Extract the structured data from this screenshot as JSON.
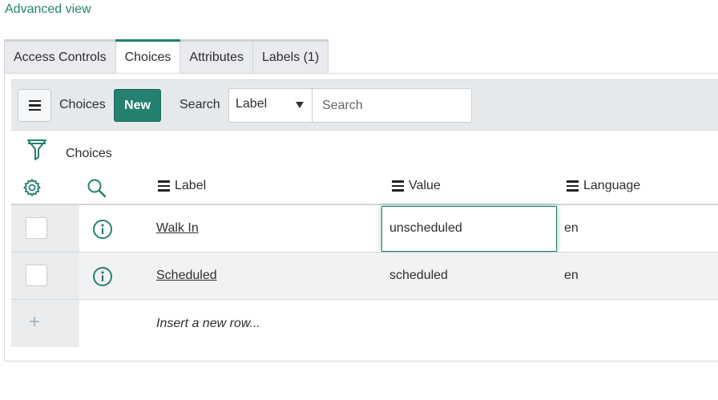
{
  "advanced_view_link": "Advanced view",
  "tabs": [
    {
      "label": "Access Controls",
      "active": false
    },
    {
      "label": "Choices",
      "active": true
    },
    {
      "label": "Attributes",
      "active": false
    },
    {
      "label": "Labels (1)",
      "active": false
    }
  ],
  "list_header": {
    "title": "Choices",
    "new_button": "New",
    "search_label": "Search",
    "search_field_selected": "Label",
    "search_placeholder": "Search"
  },
  "breadcrumb": "Choices",
  "columns": [
    "Label",
    "Value",
    "Language"
  ],
  "rows": [
    {
      "label": "Walk In",
      "value": "unscheduled",
      "language": "en",
      "editing": true
    },
    {
      "label": "Scheduled",
      "value": "scheduled",
      "language": "en",
      "editing": false
    }
  ],
  "insert_row_text": "Insert a new row...",
  "icons": {
    "list_menu": "hamburger-icon",
    "filter": "filter-funnel-icon",
    "personalize": "gear-icon",
    "column_search": "search-icon",
    "row_info": "info-icon",
    "add_row": "plus-icon"
  },
  "colors": {
    "accent": "#24806f",
    "header_bg": "#e6e9ec",
    "row_alt_bg": "#f1f2f3"
  }
}
